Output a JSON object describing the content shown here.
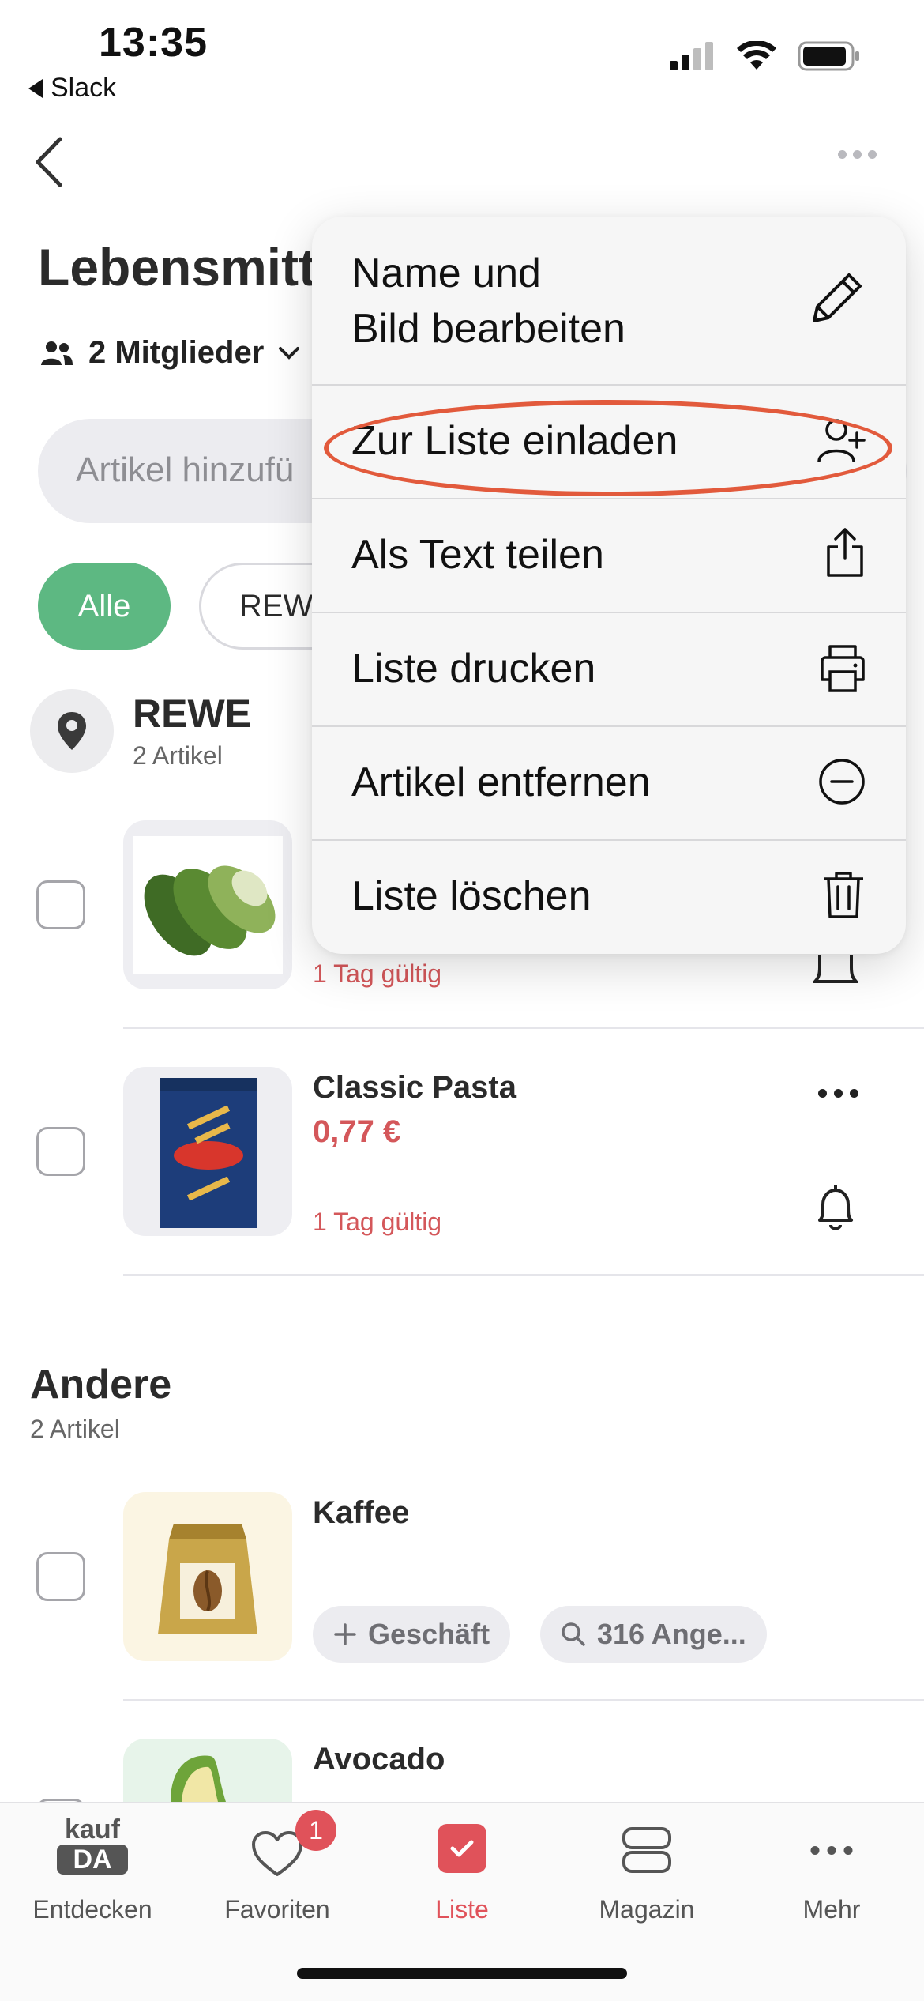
{
  "status_bar": {
    "time": "13:35",
    "back_app": "Slack"
  },
  "header": {
    "title": "Lebensmitt",
    "members": "2 Mitglieder"
  },
  "add_item": {
    "placeholder": "Artikel hinzufü"
  },
  "filters": {
    "all": "Alle",
    "rewe": "REWE"
  },
  "store_section": {
    "name": "REWE",
    "count": "2 Artikel"
  },
  "items_rewe": [
    {
      "valid": "1 Tag gültig"
    },
    {
      "name": "Classic Pasta",
      "price": "0,77 €",
      "valid": "1 Tag gültig"
    }
  ],
  "other_section": {
    "name": "Andere",
    "count": "2 Artikel"
  },
  "items_other": [
    {
      "name": "Kaffee",
      "store_chip": "Geschäft",
      "offers_chip": "316 Ange..."
    },
    {
      "name": "Avocado"
    }
  ],
  "menu": {
    "edit_line1": "Name und",
    "edit_line2": "Bild bearbeiten",
    "invite": "Zur Liste einladen",
    "share_text": "Als Text teilen",
    "print": "Liste drucken",
    "remove_items": "Artikel entfernen",
    "delete": "Liste löschen"
  },
  "tabbar": {
    "discover": "Entdecken",
    "favorites": "Favoriten",
    "favorites_badge": "1",
    "list": "Liste",
    "magazine": "Magazin",
    "more": "Mehr",
    "logo_top": "kauf",
    "logo_bottom": "DA"
  },
  "colors": {
    "accent_green": "#5db882",
    "price_red": "#d4575a",
    "tab_active": "#e0525a",
    "highlight": "#e25a3c"
  }
}
